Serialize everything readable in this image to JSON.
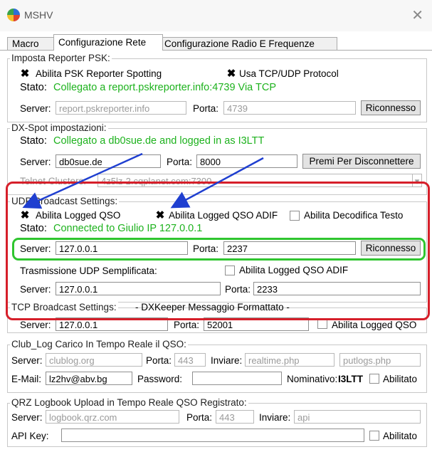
{
  "window": {
    "title": "MSHV"
  },
  "tabs": [
    "Macro",
    "Configurazione Rete",
    "Configurazione Radio E Frequenze"
  ],
  "psk": {
    "title": "Imposta Reporter PSK:",
    "enable_label": "Abilita PSK Reporter Spotting",
    "tcp_label": "Usa TCP/UDP Protocol",
    "status_label": "Stato:",
    "status_value": "Collegato a report.pskreporter.info:4739 Via TCP",
    "server_label": "Server:",
    "server_value": "report.pskreporter.info",
    "port_label": "Porta:",
    "port_value": "4739",
    "reconnect_label": "Riconnesso"
  },
  "dxspot": {
    "title": "DX-Spot impostazioni:",
    "status_label": "Stato:",
    "status_value": "Collegato a db0sue.de and logged in as I3LTT",
    "server_label": "Server:",
    "server_value": "db0sue.de",
    "port_label": "Porta:",
    "port_value": "8000",
    "disconnect_label": "Premi Per Disconnettere",
    "telnet_label": "Telnet Clusters:",
    "telnet_value": "4z5lz-2.cqplanet.com:7300"
  },
  "udp": {
    "title": "UDP Broadcast Settings:",
    "logged_qso_label": "Abilita Logged QSO",
    "logged_adif_label": "Abilita Logged QSO ADIF",
    "decode_label": "Abilita Decodifica Testo",
    "status_label": "Stato:",
    "status_value": "Connected to Giulio IP 127.0.0.1",
    "server_label": "Server:",
    "server_value": "127.0.0.1",
    "port_label": "Porta:",
    "port_value": "2237",
    "reconnect_label": "Riconnesso",
    "simple_label": "Trasmissione UDP Semplificata:",
    "simple_adif_label": "Abilita Logged QSO ADIF",
    "simple_server_label": "Server:",
    "simple_server_value": "127.0.0.1",
    "simple_port_label": "Porta:",
    "simple_port_value": "2233"
  },
  "tcp": {
    "title": "TCP Broadcast Settings:",
    "subtitle": "- DXKeeper Messaggio Formattato -",
    "server_label": "Server:",
    "server_value": "127.0.0.1",
    "port_label": "Porta:",
    "port_value": "52001",
    "enable_label": "Abilita Logged QSO"
  },
  "clublog": {
    "title": "Club_Log Carico In Tempo Reale il QSO:",
    "server_label": "Server:",
    "server_value": "clublog.org",
    "port_label": "Porta:",
    "port_value": "443",
    "send_label": "Inviare:",
    "send_value": "realtime.php",
    "putlogs_value": "putlogs.php",
    "email_label": "E-Mail:",
    "email_value": "lz2hv@abv.bg",
    "password_label": "Password:",
    "call_label": "Nominativo:",
    "call_value": "I3LTT",
    "enabled_label": "Abilitato"
  },
  "qrz": {
    "title": "QRZ Logbook Upload in Tempo Reale QSO Registrato:",
    "server_label": "Server:",
    "server_value": "logbook.qrz.com",
    "port_label": "Porta:",
    "port_value": "443",
    "send_label": "Inviare:",
    "send_value": "api",
    "apikey_label": "API Key:",
    "enabled_label": "Abilitato"
  },
  "annotations": {
    "highlight_red": "#d61f2a",
    "highlight_green": "#2fc52f",
    "arrow_color": "#1f3fd0"
  }
}
